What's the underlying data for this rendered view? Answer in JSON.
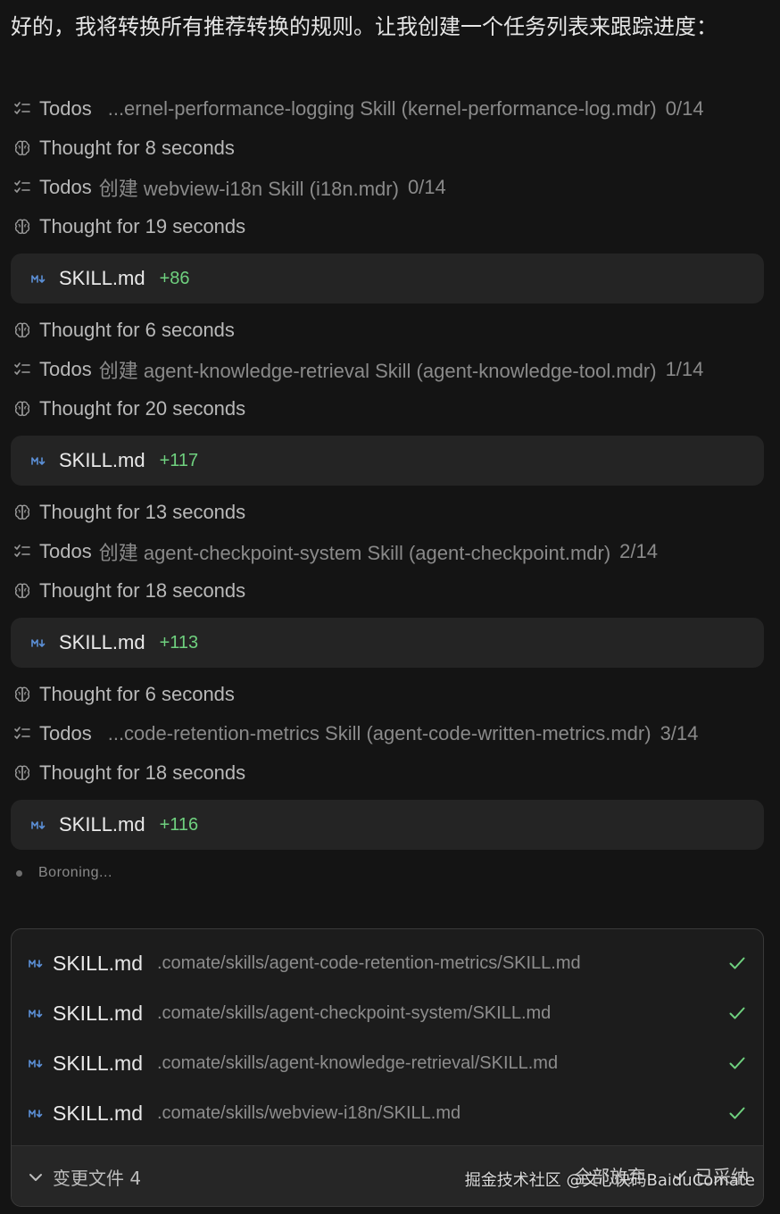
{
  "intro": {
    "text": "好的，我将转换所有推荐转换的规则。让我创建一个任务列表来跟踪进度："
  },
  "timeline": [
    {
      "kind": "todo",
      "icon": "checklist-icon",
      "label": "Todos",
      "detail": "...ernel-performance-logging Skill (kernel-performance-log.mdr)",
      "count": "0/14"
    },
    {
      "kind": "thought",
      "icon": "brain-icon",
      "label": "Thought for 8 seconds"
    },
    {
      "kind": "todo",
      "icon": "checklist-icon",
      "label": "Todos",
      "detail": "创建 webview-i18n Skill (i18n.mdr)",
      "count": "0/14"
    },
    {
      "kind": "thought",
      "icon": "brain-icon",
      "label": "Thought for 19 seconds"
    },
    {
      "kind": "file",
      "icon": "markdown-icon",
      "name": "SKILL.md",
      "added": "+86"
    },
    {
      "kind": "thought",
      "icon": "brain-icon",
      "label": "Thought for 6 seconds"
    },
    {
      "kind": "todo",
      "icon": "checklist-icon",
      "label": "Todos",
      "detail": "创建 agent-knowledge-retrieval Skill (agent-knowledge-tool.mdr)",
      "count": "1/14"
    },
    {
      "kind": "thought",
      "icon": "brain-icon",
      "label": "Thought for 20 seconds"
    },
    {
      "kind": "file",
      "icon": "markdown-icon",
      "name": "SKILL.md",
      "added": "+117"
    },
    {
      "kind": "thought",
      "icon": "brain-icon",
      "label": "Thought for 13 seconds"
    },
    {
      "kind": "todo",
      "icon": "checklist-icon",
      "label": "Todos",
      "detail": "创建 agent-checkpoint-system Skill (agent-checkpoint.mdr)",
      "count": "2/14"
    },
    {
      "kind": "thought",
      "icon": "brain-icon",
      "label": "Thought for 18 seconds"
    },
    {
      "kind": "file",
      "icon": "markdown-icon",
      "name": "SKILL.md",
      "added": "+113"
    },
    {
      "kind": "thought",
      "icon": "brain-icon",
      "label": "Thought for 6 seconds"
    },
    {
      "kind": "todo",
      "icon": "checklist-icon",
      "label": "Todos",
      "detail": "...code-retention-metrics Skill (agent-code-written-metrics.mdr)",
      "count": "3/14"
    },
    {
      "kind": "thought",
      "icon": "brain-icon",
      "label": "Thought for 18 seconds"
    },
    {
      "kind": "file",
      "icon": "markdown-icon",
      "name": "SKILL.md",
      "added": "+116"
    }
  ],
  "status": {
    "generating_label": "Boroning..."
  },
  "changed_files": {
    "files": [
      {
        "name": "SKILL.md",
        "path": ".comate/skills/agent-code-retention-metrics/SKILL.md",
        "icon": "markdown-icon",
        "status_icon": "check-icon"
      },
      {
        "name": "SKILL.md",
        "path": ".comate/skills/agent-checkpoint-system/SKILL.md",
        "icon": "markdown-icon",
        "status_icon": "check-icon"
      },
      {
        "name": "SKILL.md",
        "path": ".comate/skills/agent-knowledge-retrieval/SKILL.md",
        "icon": "markdown-icon",
        "status_icon": "check-icon"
      },
      {
        "name": "SKILL.md",
        "path": ".comate/skills/webview-i18n/SKILL.md",
        "icon": "markdown-icon",
        "status_icon": "check-icon"
      }
    ],
    "toggle_label": "变更文件 4",
    "reject_label": "全部放弃",
    "accept_label": "已采纳"
  },
  "watermark": "掘金技术社区 @文心快码BaiduComate",
  "colors": {
    "background": "#141414",
    "card": "#242424",
    "added_green": "#6fd17f",
    "markdown_blue": "#5b8fd6",
    "check_green": "#6fd17f"
  }
}
